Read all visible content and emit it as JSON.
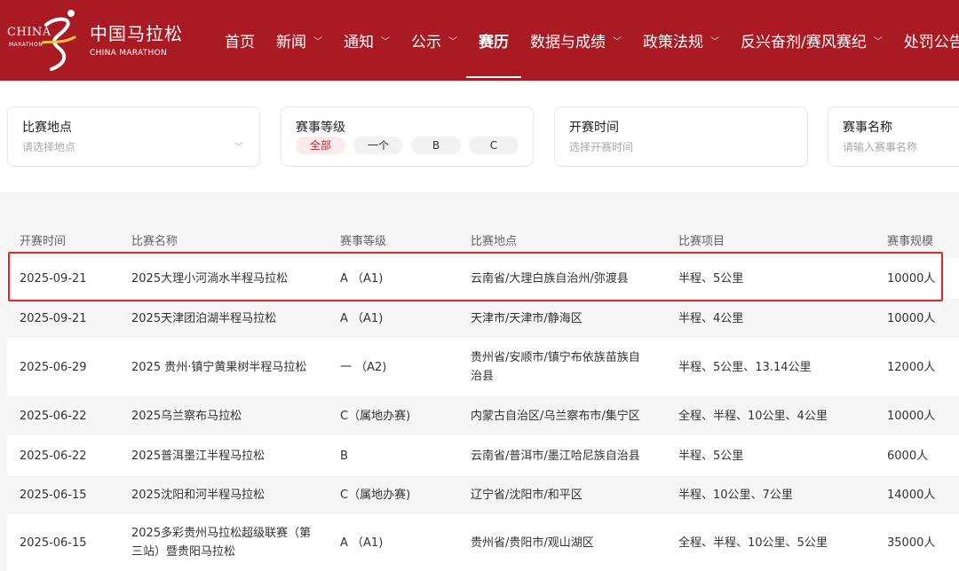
{
  "brand": {
    "logo_en_1": "CHINA",
    "logo_en_2": "MARATHON",
    "name_cn": "中国马拉松",
    "name_en": "CHINA MARATHON",
    "color": "#a91a22"
  },
  "nav": {
    "items": [
      {
        "label": "首页",
        "chevron": false,
        "active": false
      },
      {
        "label": "新闻",
        "chevron": true,
        "active": false
      },
      {
        "label": "通知",
        "chevron": true,
        "active": false
      },
      {
        "label": "公示",
        "chevron": true,
        "active": false
      },
      {
        "label": "赛历",
        "chevron": false,
        "active": true
      },
      {
        "label": "数据与成绩",
        "chevron": true,
        "active": false
      },
      {
        "label": "政策法规",
        "chevron": true,
        "active": false
      },
      {
        "label": "反兴奋剂/赛风赛纪",
        "chevron": true,
        "active": false
      },
      {
        "label": "处罚公告",
        "chevron": false,
        "active": false
      }
    ]
  },
  "filters": {
    "location": {
      "title": "比赛地点",
      "placeholder": "请选择地点"
    },
    "level": {
      "title": "赛事等级",
      "options": [
        "全部",
        "一个",
        "B",
        "C"
      ],
      "selected": "全部"
    },
    "time": {
      "title": "开赛时间",
      "placeholder": "选择开赛时间"
    },
    "name": {
      "title": "赛事名称",
      "placeholder": "请输入赛事名称"
    }
  },
  "table": {
    "headers": [
      "开赛时间",
      "比赛名称",
      "赛事等级",
      "比赛地点",
      "比赛项目",
      "赛事规模"
    ],
    "rows": [
      {
        "date": "2025-09-21",
        "name": [
          "2025大理小河淌水半程马拉松"
        ],
        "level": "A （A1)",
        "location": [
          "云南省/大理白族自治州/弥渡县"
        ],
        "events": "半程、5公里",
        "scale": "10000人"
      },
      {
        "date": "2025-09-21",
        "name": [
          "2025天津团泊湖半程马拉松"
        ],
        "level": "A （A1)",
        "location": [
          "天津市/天津市/静海区"
        ],
        "events": "半程、4公里",
        "scale": "10000人"
      },
      {
        "date": "2025-06-29",
        "name": [
          "2025 贵州·镇宁黄果树半程马拉松"
        ],
        "level": "一 （A2)",
        "location": [
          "贵州省/安顺市/镇宁布依族苗族自",
          "治县"
        ],
        "events": "半程、5公里、13.14公里",
        "scale": "12000人"
      },
      {
        "date": "2025-06-22",
        "name": [
          "2025乌兰察布马拉松"
        ],
        "level": "C（属地办赛)",
        "location": [
          "内蒙古自治区/乌兰察布市/集宁区"
        ],
        "events": "全程、半程、10公里、4公里",
        "scale": "10000人"
      },
      {
        "date": "2025-06-22",
        "name": [
          "2025普洱墨江半程马拉松"
        ],
        "level": "B",
        "location": [
          "云南省/普洱市/墨江哈尼族自治县"
        ],
        "events": "半程、5公里",
        "scale": "6000人"
      },
      {
        "date": "2025-06-15",
        "name": [
          "2025沈阳和河半程马拉松"
        ],
        "level": "C（属地办赛)",
        "location": [
          "辽宁省/沈阳市/和平区"
        ],
        "events": "半程、10公里、7公里",
        "scale": "14000人"
      },
      {
        "date": "2025-06-15",
        "name": [
          "2025多彩贵州马拉松超级联赛（第",
          "三站）暨贵阳马拉松"
        ],
        "level": "A （A1)",
        "location": [
          "贵州省/贵阳市/观山湖区"
        ],
        "events": "全程、半程、10公里、5公里",
        "scale": "35000人"
      }
    ]
  },
  "accent": "#e4262c"
}
